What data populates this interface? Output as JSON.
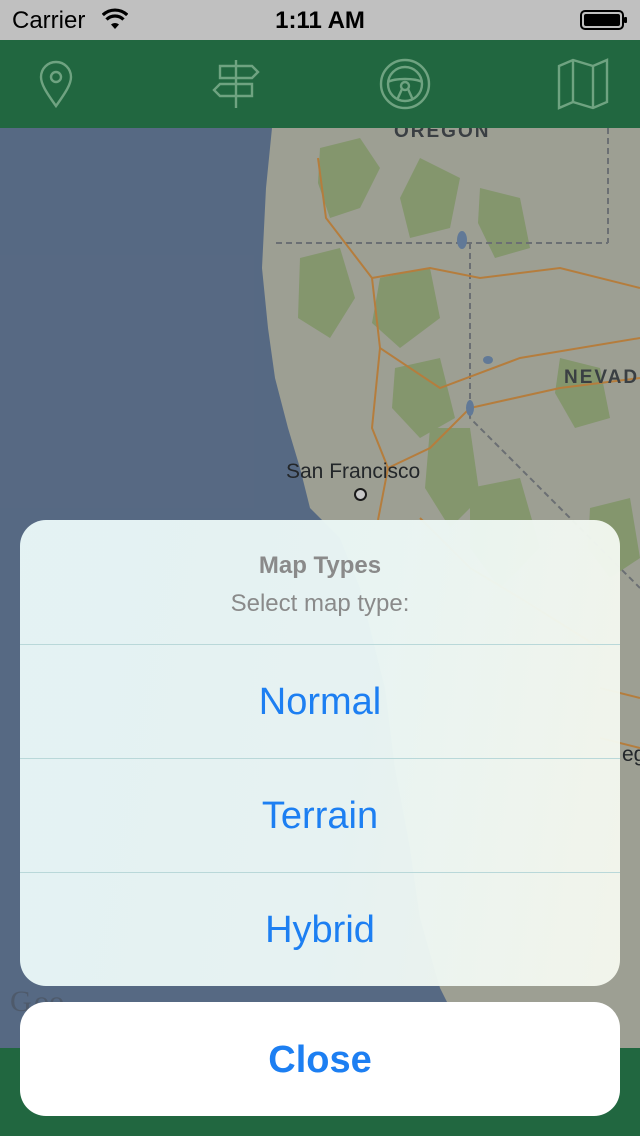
{
  "status_bar": {
    "carrier": "Carrier",
    "time": "1:11 AM"
  },
  "toolbar": {
    "items": [
      {
        "icon": "location-pin-icon"
      },
      {
        "icon": "signpost-icon"
      },
      {
        "icon": "steering-wheel-icon"
      },
      {
        "icon": "map-icon"
      }
    ],
    "icon_color": "#8fd1a6",
    "background": "#2b8552"
  },
  "map": {
    "labels": {
      "oregon": "OREGON",
      "nevada": "NEVAD",
      "city": "San Francisco",
      "edge_city": "eg"
    },
    "water_color": "#6f87a8",
    "land_color": "#c9ccbd"
  },
  "action_sheet": {
    "title": "Map Types",
    "message": "Select map type:",
    "options": [
      {
        "label": "Normal"
      },
      {
        "label": "Terrain"
      },
      {
        "label": "Hybrid"
      }
    ],
    "cancel_label": "Close",
    "tint_color": "#1d7ff2"
  }
}
